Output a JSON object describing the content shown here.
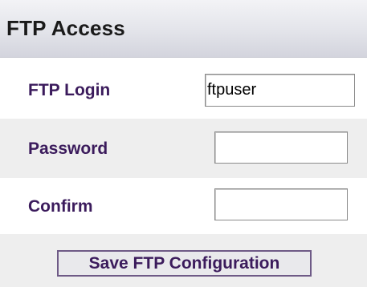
{
  "header": {
    "title": "FTP Access"
  },
  "form": {
    "login": {
      "label": "FTP Login",
      "value": "ftpuser"
    },
    "password": {
      "label": "Password",
      "value": ""
    },
    "confirm": {
      "label": "Confirm",
      "value": ""
    },
    "save_label": "Save FTP Configuration"
  },
  "colors": {
    "label_text": "#3b1b5c",
    "row_alt_bg": "#eeeeee",
    "header_bg": "#e3e4ea",
    "button_border": "#6e5a86"
  }
}
